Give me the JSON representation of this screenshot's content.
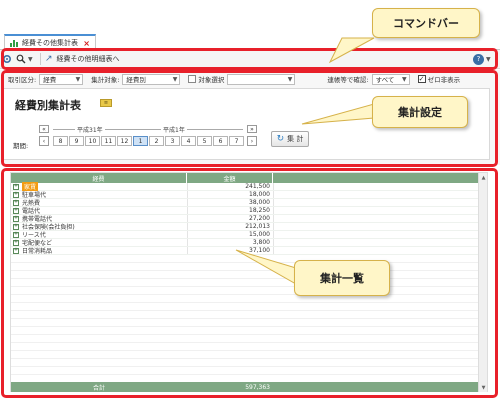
{
  "tab": {
    "title": "経費その他集計表",
    "close": "×"
  },
  "commandbar": {
    "link": "経費その他明細表へ"
  },
  "settings": {
    "torihiki_label": "取引区分:",
    "torihiki_value": "経費",
    "target_label": "集計対象:",
    "target_value": "経費別",
    "check_label": "対象選択",
    "filter_label": "連帳等で確認:",
    "filter_value": "すべて",
    "zero_label": "ゼロ非表示",
    "title": "経費別集計表",
    "period_label": "期間:",
    "era1": "平成31年",
    "era2": "平成1年",
    "months": [
      "8",
      "9",
      "10",
      "11",
      "12",
      "1",
      "2",
      "3",
      "4",
      "5",
      "6",
      "7"
    ],
    "selected_month": "1",
    "calc_button": "集 計"
  },
  "table": {
    "headers": [
      "経費",
      "金額"
    ],
    "rows": [
      {
        "name": "家賃",
        "amount": "241,500"
      },
      {
        "name": "駐車場代",
        "amount": "18,000"
      },
      {
        "name": "光熱費",
        "amount": "38,000"
      },
      {
        "name": "電話代",
        "amount": "18,250"
      },
      {
        "name": "携帯電話代",
        "amount": "27,200"
      },
      {
        "name": "社会保険(会社負担)",
        "amount": "212,013"
      },
      {
        "name": "リース代",
        "amount": "15,000"
      },
      {
        "name": "宅配便など",
        "amount": "3,800"
      },
      {
        "name": "日常消耗品",
        "amount": "37,100"
      }
    ],
    "footer_label": "合計",
    "footer_value": "597,363"
  },
  "annotations": {
    "command_bar": "コマンドバー",
    "settings": "集計設定",
    "list": "集計一覧"
  },
  "colors": {
    "accent": "#e8202a",
    "header_green": "#7fa884",
    "callout": "#fff6c8"
  }
}
